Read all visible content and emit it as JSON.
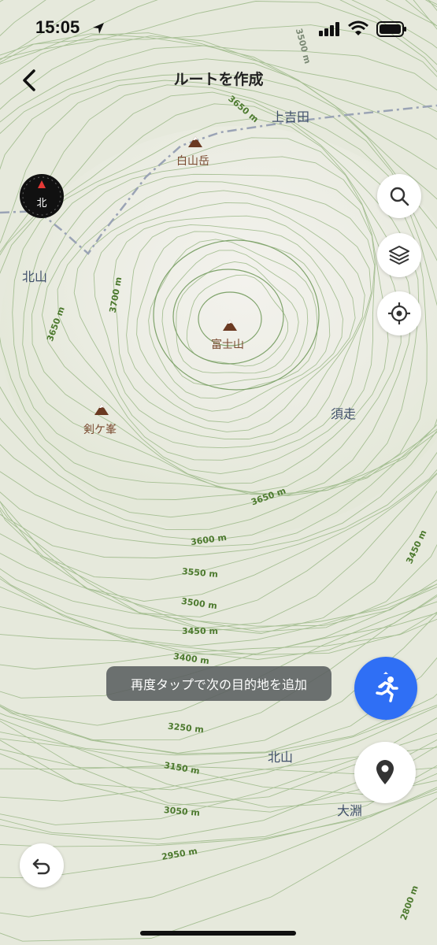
{
  "status": {
    "time": "15:05"
  },
  "header": {
    "title": "ルートを作成"
  },
  "toast": {
    "text": "再度タップで次の目的地を追加"
  },
  "compass": {
    "label": "北"
  },
  "places": {
    "kamiyoshida": "上吉田",
    "hakusandake": "白山岳",
    "kitayama1": "北山",
    "fujisan": "富士山",
    "kengamine": "剣ケ峯",
    "suso": "須走",
    "kitayama2": "北山",
    "obuchi": "大淵"
  },
  "contours": {
    "c3650a": "3650 m",
    "c3650b": "3650 m",
    "c3650c": "3650 m",
    "c3700": "3700 m",
    "c3600": "3600 m",
    "c3550": "3550 m",
    "c3500": "3500 m",
    "c3450a": "3450 m",
    "c3450b": "3450 m",
    "c3400": "3400 m",
    "c3250": "3250 m",
    "c3150": "3150 m",
    "c3050": "3050 m",
    "c2950": "2950 m",
    "c3500top": "3500 m",
    "c2800": "2800 m"
  },
  "icons": {
    "back": "chevron-left-icon",
    "search": "search-icon",
    "layers": "layers-icon",
    "locate": "crosshair-icon",
    "activity": "running-person-icon",
    "waypoint": "map-pin-icon",
    "undo": "undo-icon",
    "peak": "mountain-icon"
  },
  "colors": {
    "accent": "#2f6ff5",
    "contour": "#8fb07a",
    "peak": "#6b3a22",
    "route": "#9aa3b5"
  }
}
